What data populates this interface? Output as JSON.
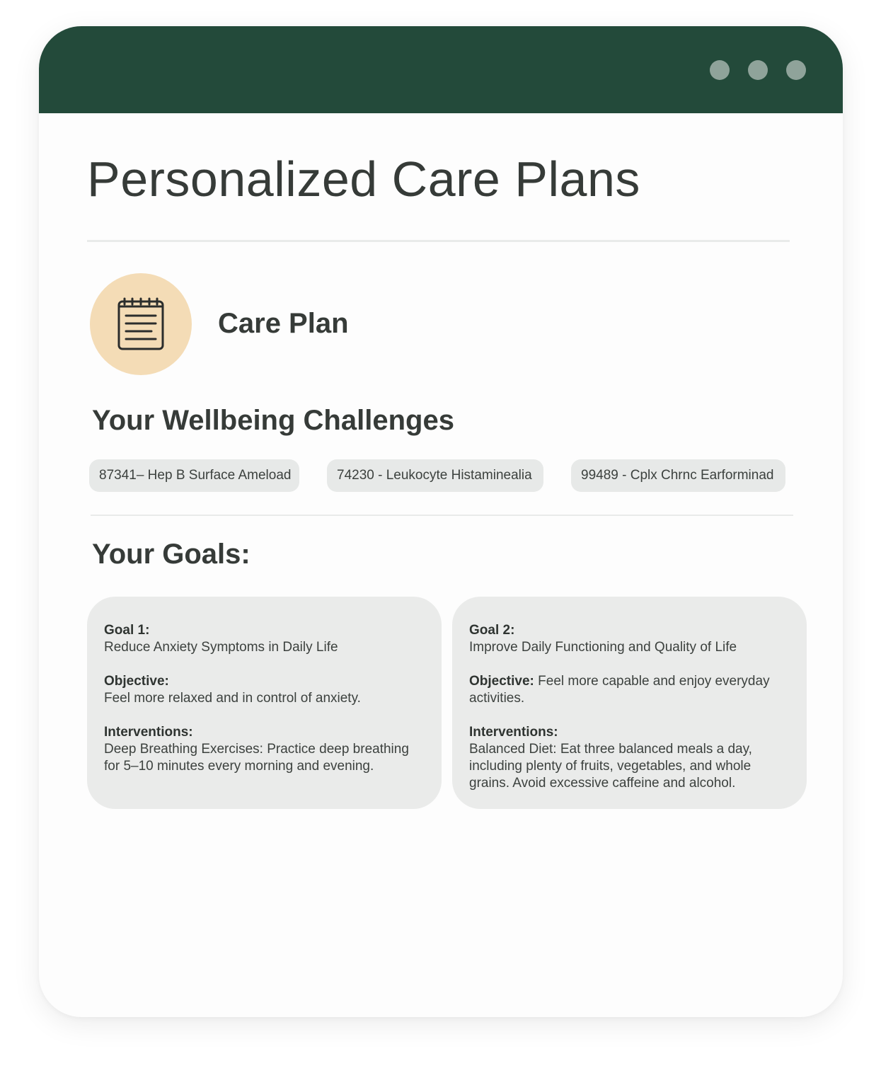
{
  "window": {
    "titlebar_color": "#234a3a",
    "controls": [
      "dot",
      "dot",
      "dot"
    ]
  },
  "page": {
    "title": "Personalized Care Plans"
  },
  "plan": {
    "icon": "notepad-icon",
    "label": "Care Plan"
  },
  "challenges": {
    "heading": "Your Wellbeing Challenges",
    "items": [
      "87341– Hep B Surface Ameload",
      "74230 - Leukocyte Histaminealia",
      "99489 - Cplx Chrnc Earforminad"
    ]
  },
  "goals": {
    "heading": "Your Goals:",
    "items": [
      {
        "goal_label": "Goal 1:",
        "goal_text": "Reduce Anxiety Symptoms in Daily Life",
        "objective_label": "Objective:",
        "objective_text": "Feel more relaxed and in control of anxiety.",
        "interventions_label": "Interventions:",
        "interventions_text": "Deep Breathing Exercises: Practice deep breathing for 5–10 minutes every morning and evening."
      },
      {
        "goal_label": "Goal 2:",
        "goal_text": "Improve Daily Functioning and Quality of Life",
        "objective_label": "Objective:",
        "objective_text": " Feel more capable and enjoy everyday activities.",
        "interventions_label": "Interventions:",
        "interventions_text": "Balanced Diet: Eat three balanced meals a day, including plenty of fruits, vegetables, and whole grains. Avoid excessive caffeine and alcohol."
      }
    ]
  }
}
